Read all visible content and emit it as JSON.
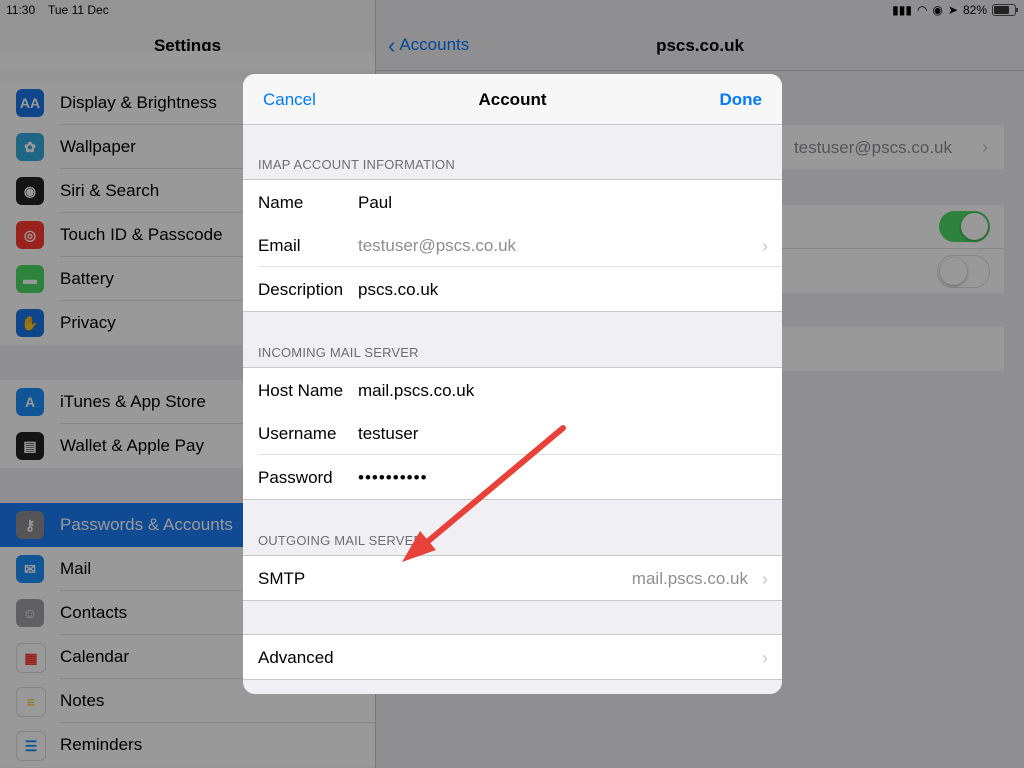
{
  "status_bar": {
    "time": "11:30",
    "date": "Tue 11 Dec",
    "battery": "82%",
    "battery_level": 0.82
  },
  "settings_panel": {
    "title": "Settings",
    "items": [
      {
        "label": "Display & Brightness",
        "icon": "display-brightness-icon",
        "color": "#1a73e8"
      },
      {
        "label": "Wallpaper",
        "icon": "wallpaper-icon",
        "color": "#34aadc"
      },
      {
        "label": "Siri & Search",
        "icon": "siri-icon",
        "color": "#222222"
      },
      {
        "label": "Touch ID & Passcode",
        "icon": "fingerprint-icon",
        "color": "#ff3b30"
      },
      {
        "label": "Battery",
        "icon": "battery-icon",
        "color": "#4cd964"
      },
      {
        "label": "Privacy",
        "icon": "privacy-hand-icon",
        "color": "#1a73e8"
      },
      {
        "label": "iTunes & App Store",
        "icon": "app-store-icon",
        "color": "#1c8ef9"
      },
      {
        "label": "Wallet & Apple Pay",
        "icon": "wallet-icon",
        "color": "#222222"
      },
      {
        "label": "Passwords & Accounts",
        "icon": "key-icon",
        "color": "#8e8e93"
      },
      {
        "label": "Mail",
        "icon": "mail-icon",
        "color": "#1c8ef9"
      },
      {
        "label": "Contacts",
        "icon": "contacts-icon",
        "color": "#a0a0a5"
      },
      {
        "label": "Calendar",
        "icon": "calendar-icon",
        "color": "#ffffff"
      },
      {
        "label": "Notes",
        "icon": "notes-icon",
        "color": "#ffffff"
      },
      {
        "label": "Reminders",
        "icon": "reminders-icon",
        "color": "#ffffff"
      }
    ]
  },
  "detail_panel": {
    "back_label": "Accounts",
    "title": "pscs.co.uk",
    "account_value": "testuser@pscs.co.uk",
    "toggle_1_on": true,
    "toggle_2_on": false,
    "accent": "#4cd964"
  },
  "modal": {
    "cancel": "Cancel",
    "title": "Account",
    "done": "Done",
    "imap_header": "IMAP ACCOUNT INFORMATION",
    "name_label": "Name",
    "name_value": "Paul",
    "email_label": "Email",
    "email_value": "testuser@pscs.co.uk",
    "description_label": "Description",
    "description_value": "pscs.co.uk",
    "incoming_header": "INCOMING MAIL SERVER",
    "host_label": "Host Name",
    "host_value": "mail.pscs.co.uk",
    "username_label": "Username",
    "username_value": "testuser",
    "password_label": "Password",
    "password_value": "••••••••••",
    "outgoing_header": "OUTGOING MAIL SERVER",
    "smtp_label": "SMTP",
    "smtp_value": "mail.pscs.co.uk",
    "advanced_label": "Advanced"
  },
  "annotation": {
    "arrow_color": "#e8413a"
  }
}
